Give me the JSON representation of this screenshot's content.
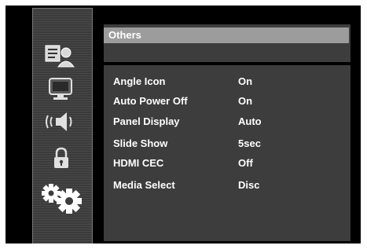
{
  "menu": {
    "section_title": "Others",
    "sidebar_icons": [
      {
        "icon": "language-icon",
        "selected": false
      },
      {
        "icon": "display-icon",
        "selected": false
      },
      {
        "icon": "audio-icon",
        "selected": false
      },
      {
        "icon": "lock-icon",
        "selected": false
      },
      {
        "icon": "gears-icon",
        "selected": true
      }
    ],
    "items": [
      {
        "label": "Angle Icon",
        "value": "On"
      },
      {
        "label": "Auto Power Off",
        "value": "On"
      },
      {
        "label": "Panel Display",
        "value": "Auto"
      },
      {
        "label": "Slide Show",
        "value": "5sec"
      },
      {
        "label": "HDMI CEC",
        "value": "Off"
      },
      {
        "label": "Media Select",
        "value": "Disc"
      }
    ]
  },
  "colors": {
    "background": "#000000",
    "panel": "#3d3d3d",
    "header_highlight": "#9c9c9c",
    "text": "#ffffff"
  }
}
